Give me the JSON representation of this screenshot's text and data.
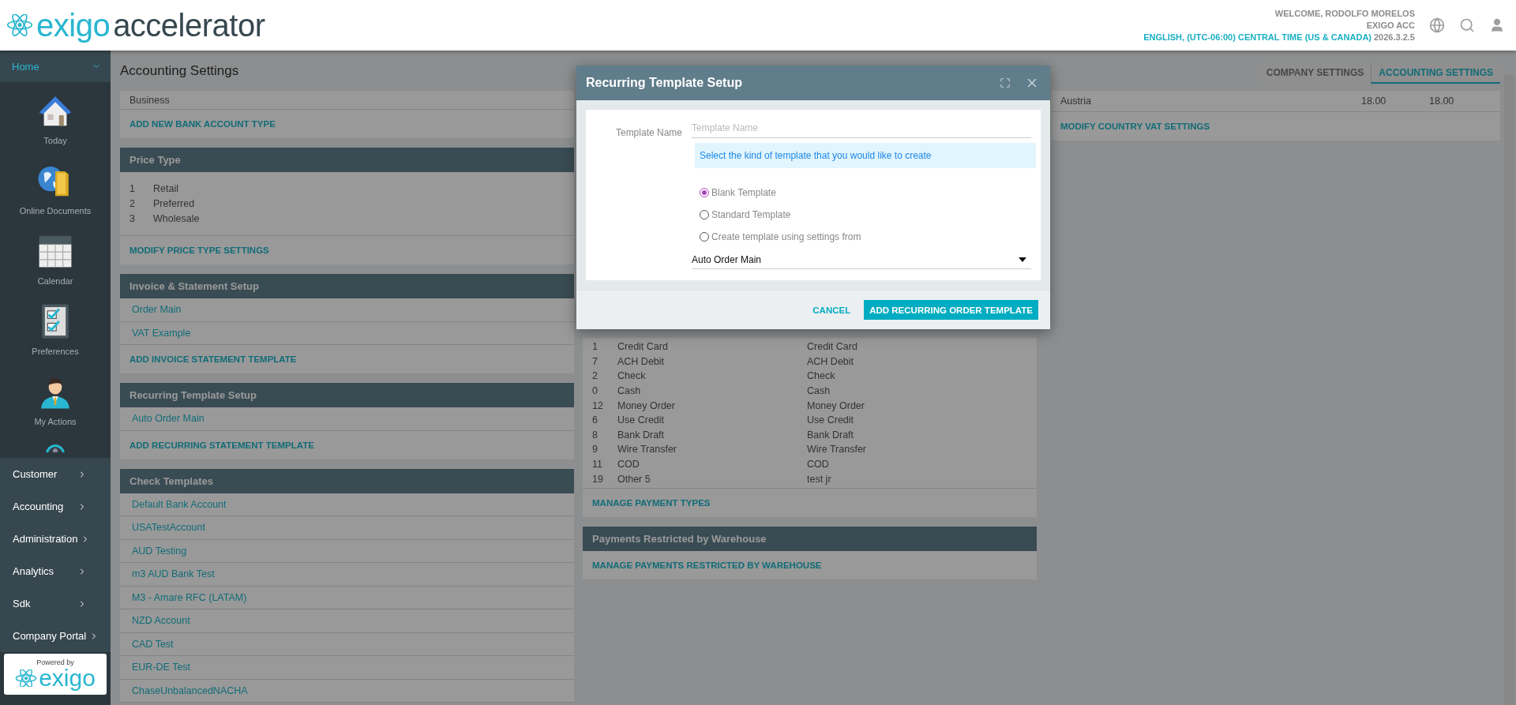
{
  "header": {
    "logo": {
      "brand": "exigo",
      "product": "accelerator"
    },
    "user": {
      "welcome": "WELCOME, RODOLFO MORELOS",
      "account": "EXIGO ACC",
      "locale": "ENGLISH, (UTC-06:00) CENTRAL TIME (US & CANADA)",
      "version": "2026.3.2.5"
    }
  },
  "sidebar": {
    "home": {
      "label": "Home",
      "expanded": true
    },
    "apps": [
      {
        "label": "Today"
      },
      {
        "label": "Online Documents"
      },
      {
        "label": "Calendar"
      },
      {
        "label": "Preferences"
      },
      {
        "label": "My Actions"
      }
    ],
    "nav": [
      "Customer",
      "Accounting",
      "Administration",
      "Analytics",
      "Sdk",
      "Company Portal"
    ],
    "powered_by": {
      "caption": "Powered by",
      "brand": "exigo"
    }
  },
  "page": {
    "title": "Accounting Settings",
    "tabs": [
      {
        "label": "COMPANY SETTINGS",
        "selected": false
      },
      {
        "label": "ACCOUNTING SETTINGS",
        "selected": true
      }
    ]
  },
  "columns": [
    {
      "sections": [
        {
          "kind": "table",
          "rows": [
            [
              "Business"
            ]
          ],
          "action": "ADD NEW BANK ACCOUNT TYPE"
        },
        {
          "kind": "table",
          "title": "Price Type",
          "rows": [
            [
              "1",
              "Retail"
            ],
            [
              "2",
              "Preferred"
            ],
            [
              "3",
              "Wholesale"
            ]
          ],
          "action": "MODIFY PRICE TYPE SETTINGS"
        },
        {
          "kind": "links",
          "title": "Invoice & Statement Setup",
          "items": [
            "Order Main",
            "VAT Example"
          ],
          "action": "ADD INVOICE STATEMENT TEMPLATE"
        },
        {
          "kind": "links",
          "title": "Recurring Template Setup",
          "items": [
            "Auto Order Main"
          ],
          "action": "ADD RECURRING STATEMENT TEMPLATE"
        },
        {
          "kind": "links",
          "title": "Check Templates",
          "items": [
            "Default Bank Account",
            "USATestAccount",
            "AUD Testing",
            "m3 AUD Bank Test",
            "M3 - Amare RFC (LATAM)",
            "NZD Account",
            "CAD Test",
            "EUR-DE Test",
            "ChaseUnbalancedNACHA"
          ]
        }
      ]
    },
    {
      "sections": [
        {
          "kind": "table",
          "rows": [
            [
              "1",
              "Credit Card",
              "Credit Card"
            ],
            [
              "7",
              "ACH Debit",
              "ACH Debit"
            ],
            [
              "2",
              "Check",
              "Check"
            ],
            [
              "0",
              "Cash",
              "Cash"
            ],
            [
              "12",
              "Money Order",
              "Money Order"
            ],
            [
              "6",
              "Use Credit",
              "Use Credit"
            ],
            [
              "8",
              "Bank Draft",
              "Bank Draft"
            ],
            [
              "9",
              "Wire Transfer",
              "Wire Transfer"
            ],
            [
              "11",
              "COD",
              "COD"
            ],
            [
              "19",
              "Other 5",
              "test jr"
            ]
          ],
          "action": "MANAGE PAYMENT TYPES"
        },
        {
          "kind": "links",
          "title": "Payments Restricted by Warehouse",
          "action": "MANAGE PAYMENTS RESTRICTED BY WAREHOUSE"
        }
      ]
    },
    {
      "sections": [
        {
          "kind": "table",
          "rows": [
            [
              "Austria",
              "18.00",
              "18.00"
            ]
          ],
          "action": "MODIFY COUNTRY VAT SETTINGS"
        }
      ]
    }
  ],
  "modal": {
    "title": "Recurring Template Setup",
    "field": {
      "label": "Template Name",
      "placeholder": "Template Name"
    },
    "info": "Select the kind of template that you would like to create",
    "options": [
      {
        "label": "Blank Template",
        "selected": true
      },
      {
        "label": "Standard Template",
        "selected": false
      },
      {
        "label": "Create template using settings from",
        "selected": false
      }
    ],
    "select": {
      "value": "Auto Order Main"
    },
    "buttons": [
      {
        "label": "CANCEL",
        "kind": "text"
      },
      {
        "label": "ADD RECURRING ORDER TEMPLATE",
        "kind": "primary"
      }
    ]
  }
}
